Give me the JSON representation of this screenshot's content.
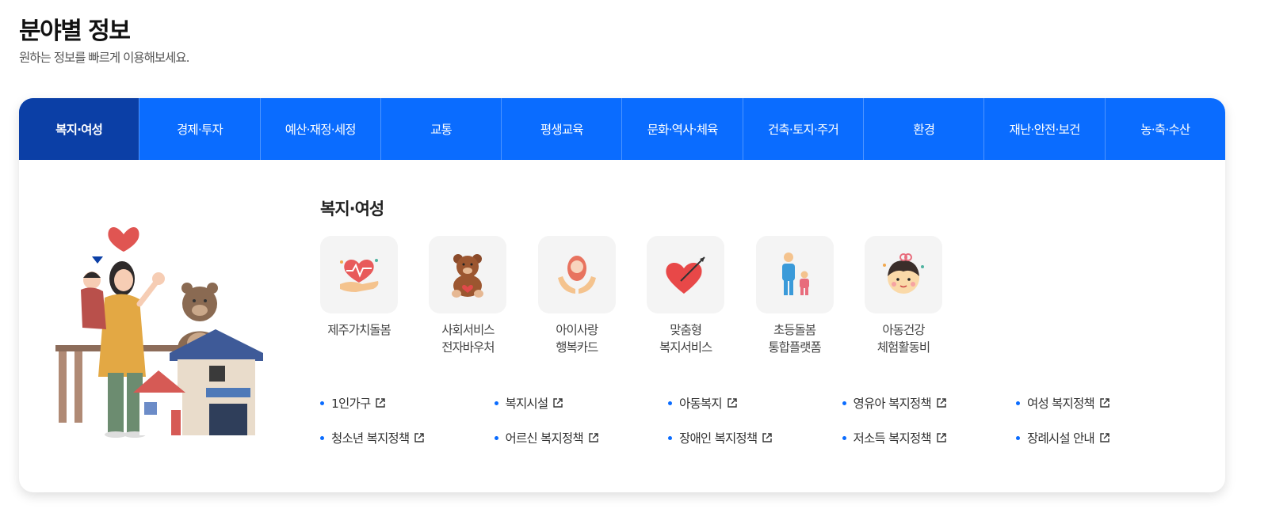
{
  "header": {
    "title": "분야별 정보",
    "subtitle": "원하는 정보를 빠르게 이용해보세요."
  },
  "colors": {
    "primary": "#0a6cff",
    "active_tab": "#0b3fa6",
    "bullet": "#0a6cff"
  },
  "tabs": [
    {
      "label": "복지·여성",
      "active": true
    },
    {
      "label": "경제·투자"
    },
    {
      "label": "예산·재정·세정"
    },
    {
      "label": "교통"
    },
    {
      "label": "평생교육"
    },
    {
      "label": "문화·역사·체육"
    },
    {
      "label": "건축·토지·주거"
    },
    {
      "label": "환경"
    },
    {
      "label": "재난·안전·보건"
    },
    {
      "label": "농·축·수산"
    }
  ],
  "section": {
    "title": "복지·여성",
    "services": [
      {
        "line1": "제주가치돌봄",
        "line2": "",
        "icon": "heart-hand-icon"
      },
      {
        "line1": "사회서비스",
        "line2": "전자바우처",
        "icon": "teddy-bear-icon"
      },
      {
        "line1": "아이사랑",
        "line2": "행복카드",
        "icon": "baby-hands-icon"
      },
      {
        "line1": "맞춤형",
        "line2": "복지서비스",
        "icon": "heart-arrow-icon"
      },
      {
        "line1": "초등돌봄",
        "line2": "통합플랫폼",
        "icon": "parent-child-icon"
      },
      {
        "line1": "아동건강",
        "line2": "체험활동비",
        "icon": "child-face-icon"
      }
    ],
    "links": [
      "1인가구",
      "복지시설",
      "아동복지",
      "영유아 복지정책",
      "여성 복지정책",
      "청소년 복지정책",
      "어르신 복지정책",
      "장애인 복지정책",
      "저소득 복지정책",
      "장례시설 안내"
    ]
  }
}
